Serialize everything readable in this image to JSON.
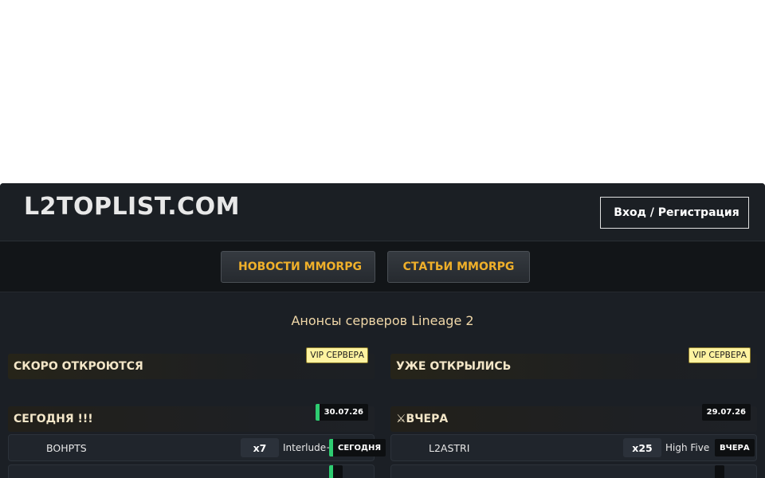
{
  "header": {
    "logo": "L2TOPLIST.COM",
    "login_label": "Вход / Регистрация",
    "login_icon": "user-icon"
  },
  "nav": {
    "news_label": "НОВОСТИ MMORPG",
    "articles_label": "СТАТЬИ MMORPG",
    "news_icon": "newspaper-icon"
  },
  "main": {
    "section_title": "Анонсы серверов Lineage 2",
    "left": {
      "title": "СКОРО ОТКРОЮТСЯ",
      "vip_badge": "VIP СЕРВЕРА",
      "day_title": "СЕГОДНЯ !!!",
      "day_date": "30.07.26",
      "rows": [
        {
          "name": "BOHPTS",
          "rate": "x7",
          "chronicle": "Interlude+",
          "status": "СЕГОДНЯ"
        }
      ]
    },
    "right": {
      "title": "УЖЕ ОТКРЫЛИСЬ",
      "vip_badge": "VIP СЕРВЕРА",
      "day_title": "⚔ВЧЕРА",
      "day_date": "29.07.26",
      "rows": [
        {
          "name": "L2ASTRI",
          "rate": "x25",
          "chronicle": "High Five",
          "status": "ВЧЕРА"
        }
      ]
    }
  },
  "colors": {
    "accent": "#f0b02a",
    "status_green": "#2ecc71",
    "badge_yellow": "#fff3a0"
  }
}
